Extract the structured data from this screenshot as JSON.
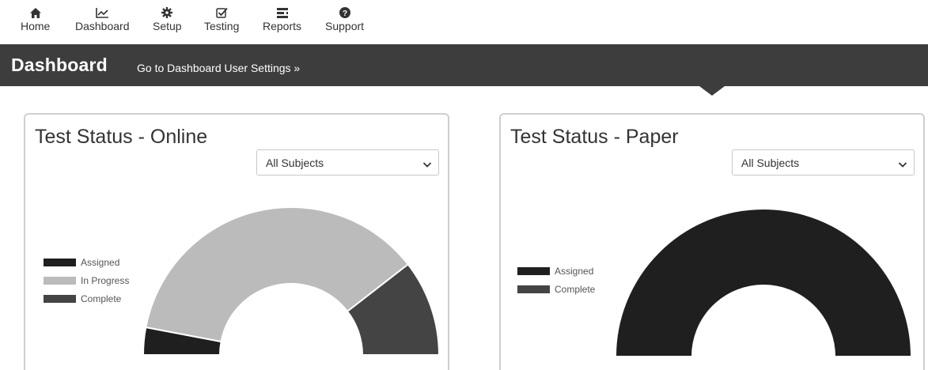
{
  "nav": {
    "items": [
      {
        "label": "Home",
        "icon": "home-icon"
      },
      {
        "label": "Dashboard",
        "icon": "chart-line-icon"
      },
      {
        "label": "Setup",
        "icon": "gear-icon"
      },
      {
        "label": "Testing",
        "icon": "checkbox-icon"
      },
      {
        "label": "Reports",
        "icon": "list-icon"
      },
      {
        "label": "Support",
        "icon": "question-circle-icon"
      }
    ]
  },
  "header": {
    "title": "Dashboard",
    "settings_link": "Go to Dashboard User Settings »"
  },
  "cards": [
    {
      "title": "Test Status - Online",
      "filter": {
        "selected": "All Subjects"
      },
      "legend": [
        {
          "label": "Assigned",
          "color": "#1f1f1f"
        },
        {
          "label": "In Progress",
          "color": "#bbbbbb"
        },
        {
          "label": "Complete",
          "color": "#444444"
        }
      ]
    },
    {
      "title": "Test Status - Paper",
      "filter": {
        "selected": "All Subjects"
      },
      "legend": [
        {
          "label": "Assigned",
          "color": "#1f1f1f"
        },
        {
          "label": "Complete",
          "color": "#444444"
        }
      ]
    }
  ],
  "chart_data": [
    {
      "type": "pie",
      "variant": "half-donut",
      "labels": [
        "Assigned",
        "In Progress",
        "Complete"
      ],
      "values": [
        0.06,
        0.73,
        0.21
      ],
      "colors": [
        "#1f1f1f",
        "#bbbbbb",
        "#444444"
      ],
      "legend_position": "left"
    },
    {
      "type": "pie",
      "variant": "half-donut",
      "labels": [
        "Assigned",
        "Complete"
      ],
      "values": [
        1.0,
        0.0
      ],
      "colors": [
        "#1f1f1f",
        "#444444"
      ],
      "legend_position": "left"
    }
  ]
}
